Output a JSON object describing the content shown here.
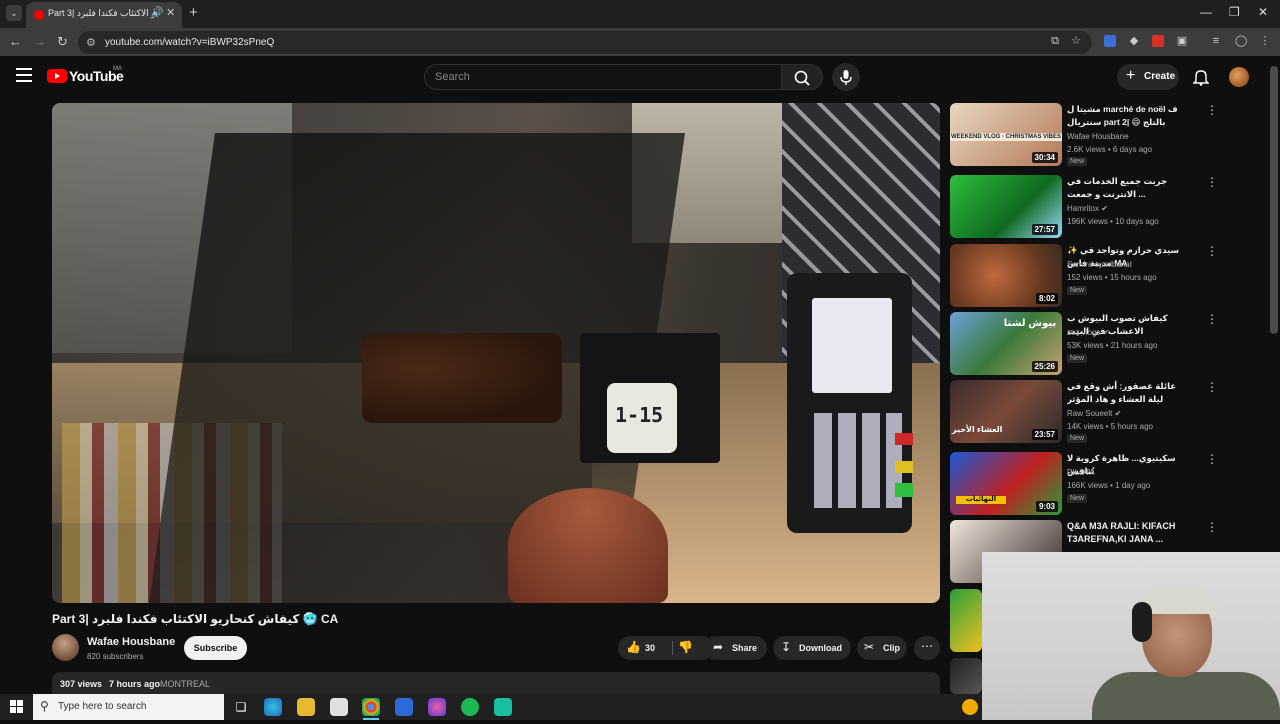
{
  "browser": {
    "tab_title": "Part 3| كيفاش كنحاريو الاكتئاب فكندا فلبرد",
    "url": "youtube.com/watch?v=iBWP32sPneQ"
  },
  "header": {
    "logo_text": "YouTube",
    "country_code": "MA",
    "search_placeholder": "Search",
    "create_label": "Create"
  },
  "video": {
    "title": "Part 3| كيفاش كنحاريو الاكتئاب فكندا فلبرد 🥶 CA",
    "overlay_text": "1-15",
    "channel": "Wafae Housbane",
    "subscribers": "820 subscribers",
    "subscribe_label": "Subscribe",
    "likes": "30",
    "share_label": "Share",
    "download_label": "Download",
    "clip_label": "Clip",
    "views": "307 views",
    "date": "7 hours ago",
    "location_tag": "MONTREAL"
  },
  "recommendations": [
    {
      "title": "مشيتا ل marché de noël ف سنتريال part 2| 😄 بالتلج",
      "channel": "Wafae Housbane",
      "meta": "2.6K views • 6 days ago",
      "badge": "New",
      "duration": "30:34",
      "banner": "WEEKEND VLOG · CHRISTMAS VIBES"
    },
    {
      "title": "جربت جميع الخدمات في الانترنت و جمعت ...",
      "channel": "Hamritox",
      "meta": "196K views • 10 days ago",
      "badge": "",
      "duration": "27:57"
    },
    {
      "title": "✨ سيدي حرازم وتواجد في مدينة فاس MA",
      "channel": "Samira oumlbanat",
      "meta": "152 views • 15 hours ago",
      "badge": "New",
      "duration": "8:02"
    },
    {
      "title": "كيفاش تصوب البيوش ب الاعشاب في البيت",
      "channel": "zoz vlogs",
      "meta": "53K views • 21 hours ago",
      "badge": "New",
      "duration": "25:26",
      "banner": "بيوش لشتا"
    },
    {
      "title": "عائلة عصفور: أش وقع في ليلة العشاء و هاد المؤثر عاشوه",
      "channel": "Raw Soueelt",
      "meta": "14K views • 5 hours ago",
      "badge": "New",
      "duration": "23:57",
      "banner": "العشاء الأخير"
    },
    {
      "title": "سكيتيوي... ظاهرة كروية لا تُنافس",
      "channel": "PILOTA",
      "meta": "166K views • 1 day ago",
      "badge": "New",
      "duration": "9:03",
      "banner": "النهائيات"
    },
    {
      "title": "Q&A M3A RAJLI: KIFACH T3AREFNA,KI JANA ...",
      "channel": "",
      "meta": "",
      "badge": "",
      "duration": ""
    }
  ],
  "taskbar": {
    "search_placeholder": "Type here to search"
  },
  "colors": {
    "brand_red": "#ff0000",
    "background": "#0f0f0f",
    "pill": "#272727"
  }
}
